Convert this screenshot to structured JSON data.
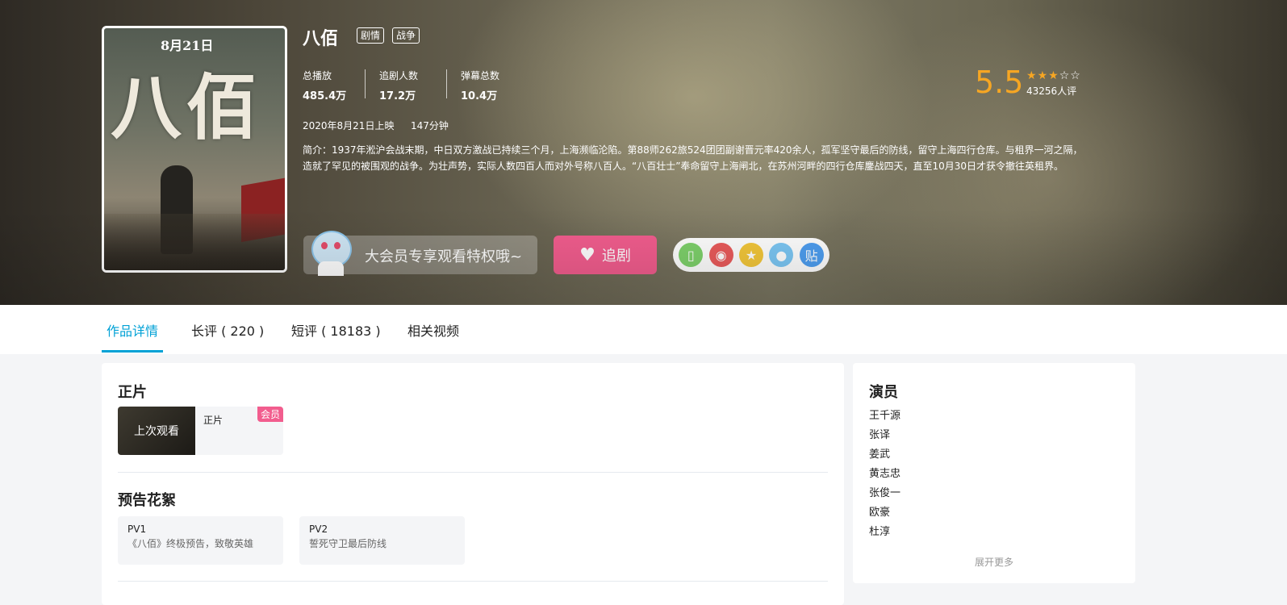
{
  "show": {
    "title": "八佰",
    "tags": [
      "剧情",
      "战争"
    ],
    "stats": [
      {
        "label": "总播放",
        "value": "485.4万"
      },
      {
        "label": "追剧人数",
        "value": "17.2万"
      },
      {
        "label": "弹幕总数",
        "value": "10.4万"
      }
    ],
    "release": "2020年8月21日上映",
    "duration": "147分钟",
    "description": "简介：1937年淞沪会战末期，中日双方激战已持续三个月，上海濒临沦陷。第88师262旅524团团副谢晋元率420余人，孤军坚守最后的防线，留守上海四行仓库。与租界一河之隔，造就了罕见的被围观的战争。为壮声势，实际人数四百人而对外号称八百人。“八百壮士”奉命留守上海闸北，在苏州河畔的四行仓库鏖战四天，直至10月30日才获令撤往英租界。",
    "rating": "5.5",
    "stars_filled": 3,
    "stars_total": 5,
    "rating_count": "43256人评",
    "poster": {
      "date": "8月21日",
      "title_art": "八佰"
    }
  },
  "actions": {
    "vip_text": "大会员专享观看特权哦~",
    "follow_label": "追剧",
    "share_icons": [
      {
        "name": "phone-icon",
        "glyph": "▯",
        "color": "#7ed16b"
      },
      {
        "name": "weibo-icon",
        "glyph": "◉",
        "color": "#ea5b5b"
      },
      {
        "name": "qzone-icon",
        "glyph": "★",
        "color": "#f3c73a"
      },
      {
        "name": "qq-icon",
        "glyph": "●",
        "color": "#7cc7f4"
      },
      {
        "name": "tieba-icon",
        "glyph": "贴",
        "color": "#4e9ef0"
      }
    ]
  },
  "tabs": [
    "作品详情",
    "长评 ( 220 )",
    "短评 ( 18183 )",
    "相关视频"
  ],
  "main": {
    "section1": "正片",
    "episode": {
      "thumb_text": "上次观看",
      "name": "正片",
      "badge": "会员"
    },
    "section2": "预告花絮",
    "pvs": [
      {
        "title": "PV1",
        "subtitle": "《八佰》终极预告，致敬英雄"
      },
      {
        "title": "PV2",
        "subtitle": "誓死守卫最后防线"
      }
    ]
  },
  "side": {
    "title": "演员",
    "actors": [
      "王千源",
      "张译",
      "姜武",
      "黄志忠",
      "张俊一",
      "欧豪",
      "杜淳"
    ],
    "more": "展开更多"
  }
}
